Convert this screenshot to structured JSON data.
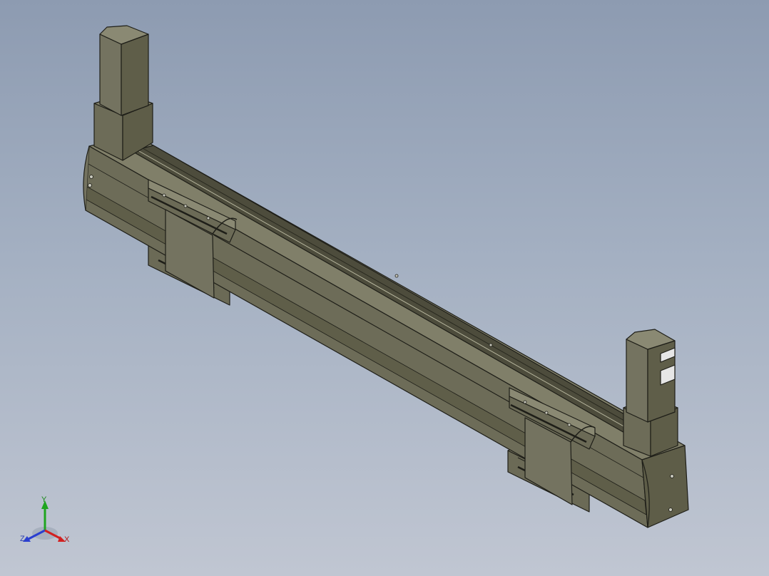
{
  "viewport": {
    "background_top": "#8d9bb1",
    "background_bottom": "#c0c6d2"
  },
  "model": {
    "body_color": "#6d6c58",
    "body_light": "#807f69",
    "body_dark": "#56553f",
    "edge_color": "#1e1e18",
    "motor_color": "#747360",
    "connector_color": "#e6e6e6"
  },
  "triad": {
    "x_label": "X",
    "y_label": "Y",
    "z_label": "Z",
    "x_color": "#d22020",
    "y_color": "#1fa51f",
    "z_color": "#2a3fd0"
  }
}
